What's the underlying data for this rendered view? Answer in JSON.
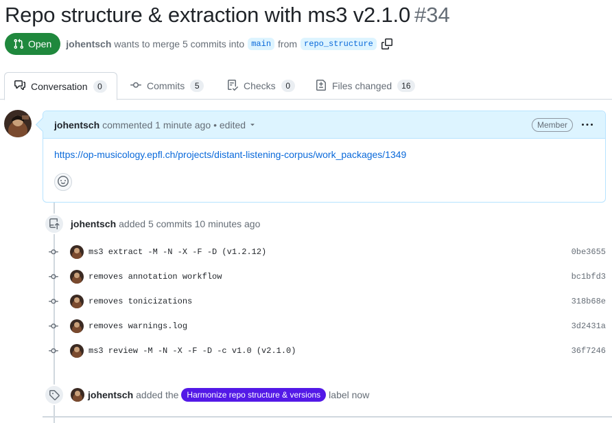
{
  "pr": {
    "title": "Repo structure & extraction with ms3 v2.1.0",
    "number": "#34",
    "state": "Open",
    "author": "johentsch",
    "merge_text_1": "wants to merge 5 commits into",
    "base_branch": "main",
    "merge_text_2": "from",
    "head_branch": "repo_structure"
  },
  "tabs": [
    {
      "label": "Conversation",
      "count": "0",
      "icon": "comment-discussion-icon"
    },
    {
      "label": "Commits",
      "count": "5",
      "icon": "git-commit-icon"
    },
    {
      "label": "Checks",
      "count": "0",
      "icon": "checklist-icon"
    },
    {
      "label": "Files changed",
      "count": "16",
      "icon": "file-diff-icon"
    }
  ],
  "comment": {
    "author": "johentsch",
    "action": "commented 1 minute ago",
    "edited": "• edited",
    "role": "Member",
    "link": "https://op-musicology.epfl.ch/projects/distant-listening-corpus/work_packages/1349"
  },
  "commits_event": {
    "author": "johentsch",
    "text": "added 5 commits 10 minutes ago"
  },
  "commits": [
    {
      "message": "ms3 extract -M -N -X -F -D (v1.2.12)",
      "sha": "0be3655"
    },
    {
      "message": "removes annotation workflow",
      "sha": "bc1bfd3"
    },
    {
      "message": "removes tonicizations",
      "sha": "318b68e"
    },
    {
      "message": "removes warnings.log",
      "sha": "3d2431a"
    },
    {
      "message": "ms3 review -M -N -X -F -D -c v1.0 (v2.1.0)",
      "sha": "36f7246"
    }
  ],
  "label_event": {
    "author": "johentsch",
    "text_1": "added the",
    "label": "Harmonize repo structure & versions",
    "label_color": "#5319e7",
    "text_2": "label now"
  },
  "colors": {
    "open_green": "#1f883d",
    "link_blue": "#0969da",
    "header_blue": "#ddf4ff"
  }
}
